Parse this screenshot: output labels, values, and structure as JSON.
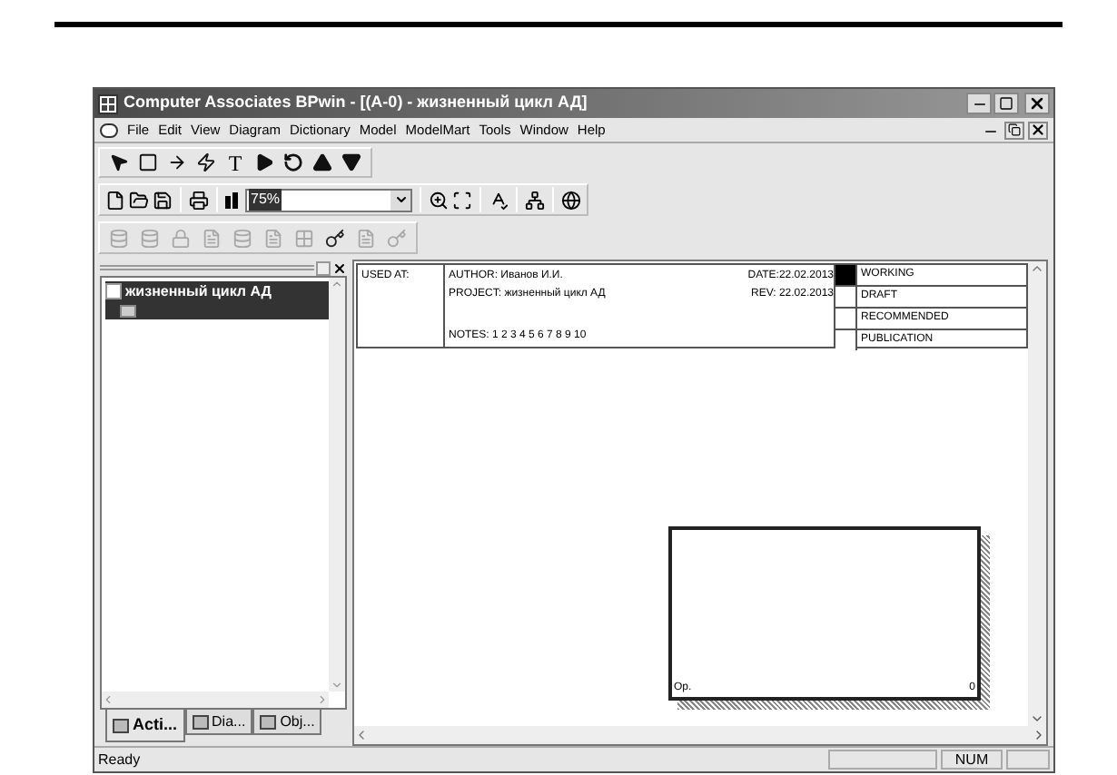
{
  "window": {
    "title": "Computer Associates BPwin - [(A-0) - жизненный цикл АД]"
  },
  "menu": [
    "File",
    "Edit",
    "View",
    "Diagram",
    "Dictionary",
    "Model",
    "ModelMart",
    "Tools",
    "Window",
    "Help"
  ],
  "drawing_tools": [
    {
      "kind": "pointer"
    },
    {
      "kind": "box"
    },
    {
      "kind": "arrow"
    },
    {
      "kind": "squiggle"
    },
    {
      "kind": "text",
      "label": "T"
    },
    {
      "kind": "play"
    },
    {
      "kind": "undo"
    },
    {
      "kind": "up"
    },
    {
      "kind": "down"
    }
  ],
  "zoom": {
    "value": "75%"
  },
  "model_tools": [
    {
      "kind": "cylinder",
      "disabled": true
    },
    {
      "kind": "cylinder",
      "disabled": true
    },
    {
      "kind": "lock",
      "disabled": true
    },
    {
      "kind": "page",
      "disabled": true
    },
    {
      "kind": "cylinder",
      "disabled": true
    },
    {
      "kind": "page",
      "disabled": true
    },
    {
      "kind": "grid",
      "disabled": true
    },
    {
      "kind": "key",
      "disabled": false
    },
    {
      "kind": "page",
      "disabled": true
    },
    {
      "kind": "key",
      "disabled": true
    }
  ],
  "explorer": {
    "tree": [
      {
        "label": "жизненный цикл АД",
        "selected": true,
        "children": [
          {
            "kind": "diagram",
            "selected": true
          }
        ]
      }
    ],
    "tabs": [
      {
        "label": "Acti...",
        "selected": true
      },
      {
        "label": "Dia...",
        "selected": false
      },
      {
        "label": "Obj...",
        "selected": false
      }
    ]
  },
  "frame": {
    "used_at": "USED AT:",
    "author_label": "AUTHOR:",
    "author": "Иванов И.И.",
    "project_label": "PROJECT:",
    "project": "жизненный цикл АД",
    "notes_label": "NOTES:",
    "notes": "1 2 3 4 5 6 7 8 9 10",
    "date_label": "DATE:",
    "date": "22.02.2013",
    "rev_label": "REV:",
    "rev": "22.02.2013",
    "statuses": [
      {
        "label": "WORKING",
        "selected": true
      },
      {
        "label": "DRAFT",
        "selected": false
      },
      {
        "label": "RECOMMENDED",
        "selected": false
      },
      {
        "label": "PUBLICATION",
        "selected": false
      }
    ]
  },
  "activity_box": {
    "name": "Op.",
    "number": "0"
  },
  "status_bar": {
    "text": "Ready",
    "indicators": [
      "NUM"
    ]
  }
}
